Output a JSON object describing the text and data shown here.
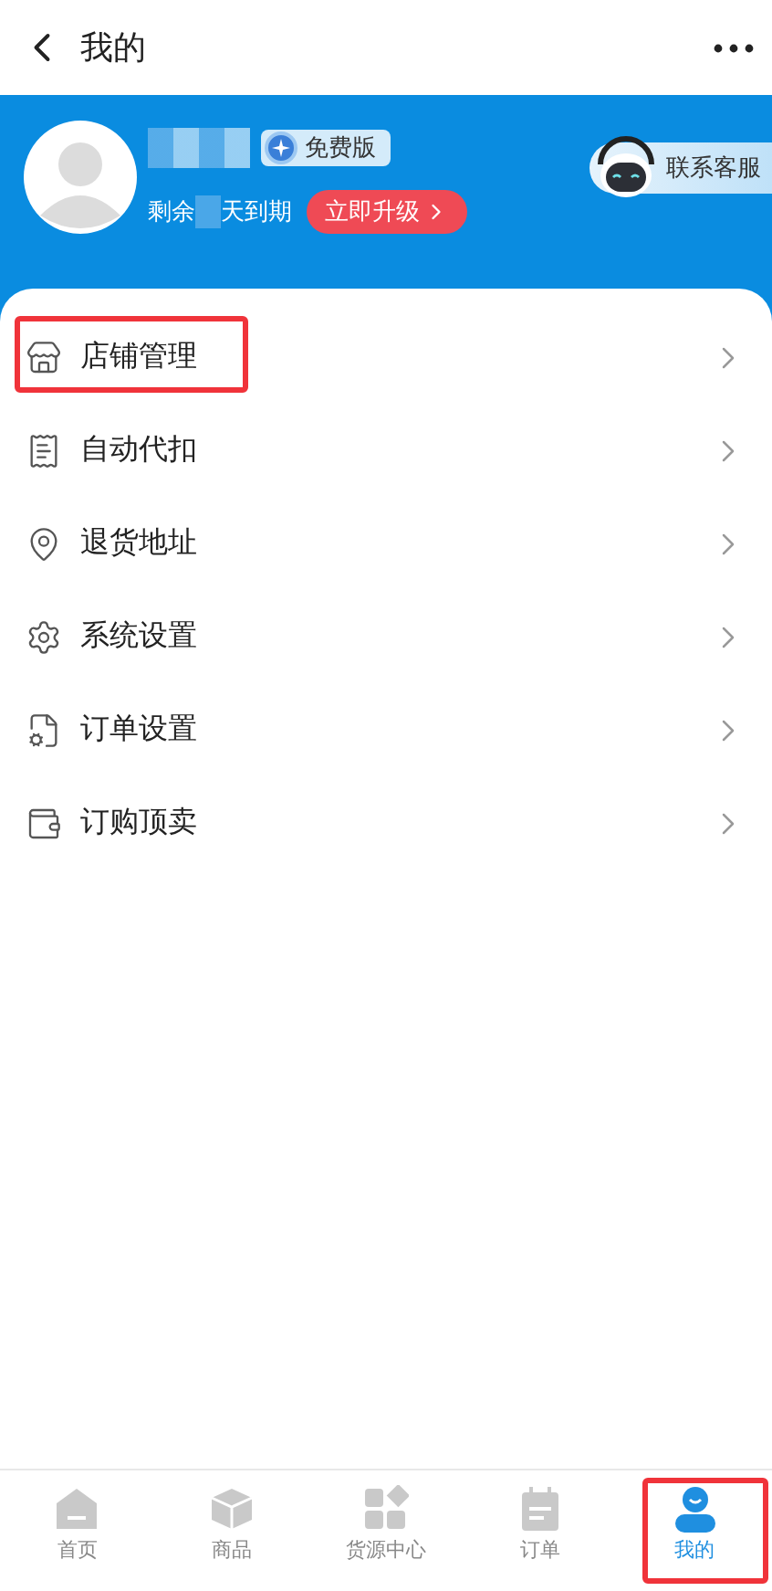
{
  "header": {
    "title": "我的"
  },
  "profile": {
    "plan_badge": "免费版",
    "expiry_prefix": "剩余",
    "expiry_suffix": "天到期",
    "upgrade_button": "立即升级",
    "support_button": "联系客服"
  },
  "menu": [
    {
      "label": "店铺管理",
      "kind": "store",
      "highlighted": true
    },
    {
      "label": "自动代扣",
      "kind": "deduct",
      "highlighted": false
    },
    {
      "label": "退货地址",
      "kind": "location",
      "highlighted": false
    },
    {
      "label": "系统设置",
      "kind": "settings",
      "highlighted": false
    },
    {
      "label": "订单设置",
      "kind": "order",
      "highlighted": false
    },
    {
      "label": "订购顶卖",
      "kind": "moneybag",
      "highlighted": false
    }
  ],
  "tabs": [
    {
      "label": "首页",
      "kind": "home",
      "selected": false,
      "highlighted": false
    },
    {
      "label": "商品",
      "kind": "goods",
      "selected": false,
      "highlighted": false
    },
    {
      "label": "货源中心",
      "kind": "source",
      "selected": false,
      "highlighted": false
    },
    {
      "label": "订单",
      "kind": "orders",
      "selected": false,
      "highlighted": false
    },
    {
      "label": "我的",
      "kind": "me",
      "selected": true,
      "highlighted": true
    }
  ]
}
